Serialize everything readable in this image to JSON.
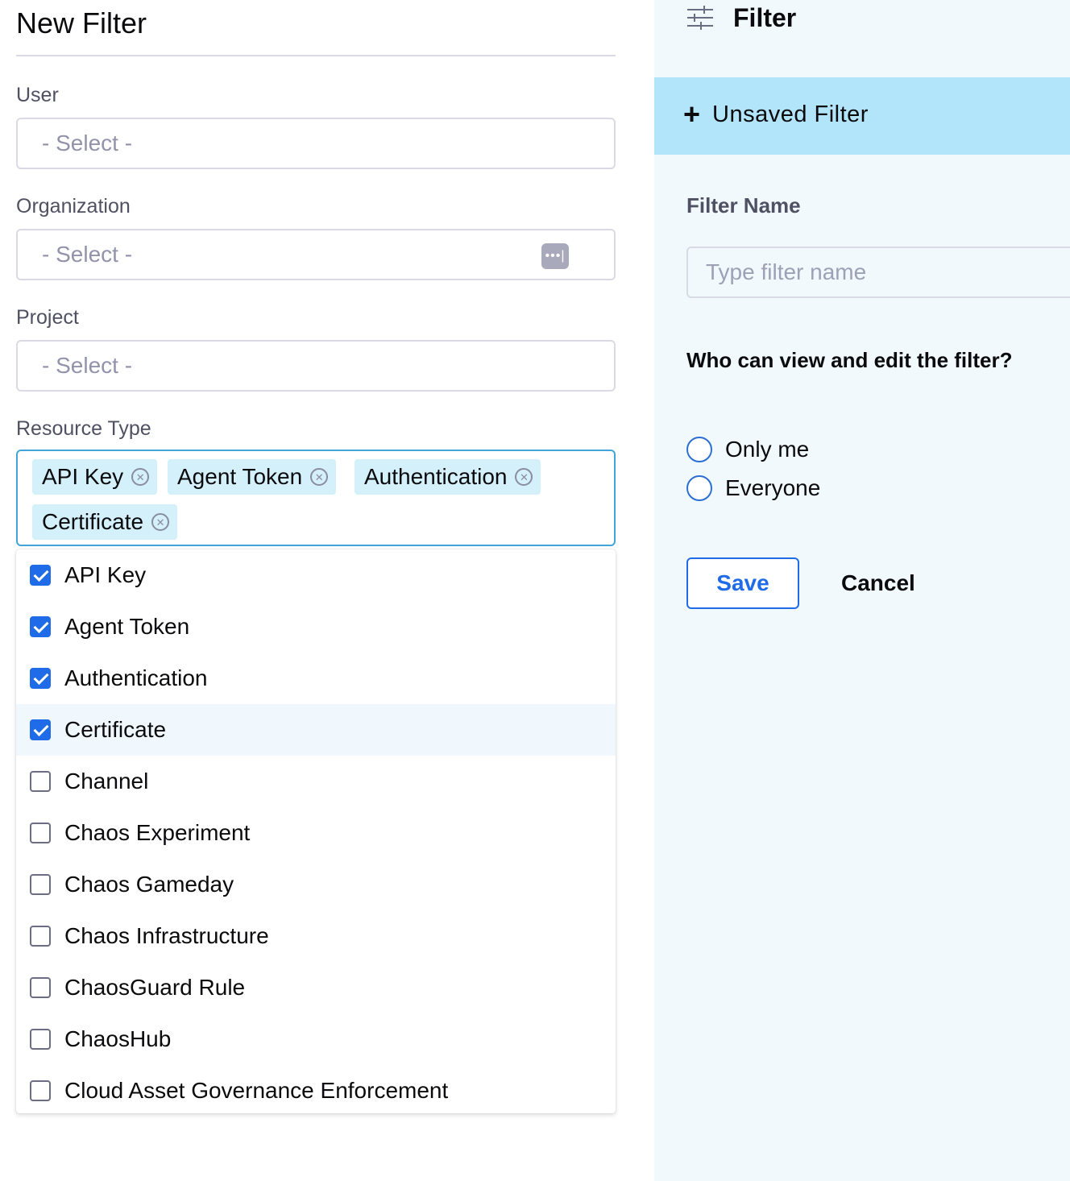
{
  "left": {
    "title": "New Filter",
    "fields": {
      "user": {
        "label": "User",
        "placeholder": "- Select -"
      },
      "organization": {
        "label": "Organization",
        "placeholder": "- Select -",
        "button": "•••|"
      },
      "project": {
        "label": "Project",
        "placeholder": "- Select -"
      },
      "resource_type": {
        "label": "Resource Type"
      }
    },
    "chips": [
      "API Key",
      "Agent Token",
      "Authentication",
      "Certificate"
    ],
    "chip_remove_glyph": "✕",
    "options": [
      {
        "label": "API Key",
        "checked": true
      },
      {
        "label": "Agent Token",
        "checked": true
      },
      {
        "label": "Authentication",
        "checked": true
      },
      {
        "label": "Certificate",
        "checked": true
      },
      {
        "label": "Channel",
        "checked": false
      },
      {
        "label": "Chaos Experiment",
        "checked": false
      },
      {
        "label": "Chaos Gameday",
        "checked": false
      },
      {
        "label": "Chaos Infrastructure",
        "checked": false
      },
      {
        "label": "ChaosGuard Rule",
        "checked": false
      },
      {
        "label": "ChaosHub",
        "checked": false
      },
      {
        "label": "Cloud Asset Governance Enforcement",
        "checked": false
      }
    ]
  },
  "right": {
    "title": "Filter",
    "unsaved_label": "Unsaved Filter",
    "filter_name_label": "Filter Name",
    "filter_name_placeholder": "Type filter name",
    "visibility_question": "Who can view and edit the filter?",
    "radio_options": [
      "Only me",
      "Everyone"
    ],
    "save_label": "Save",
    "cancel_label": "Cancel"
  },
  "colors": {
    "accent": "#1f6be8",
    "chip_bg": "#d4f0fb",
    "unsaved_bg": "#b3e5fa",
    "panel_bg": "#f2f9fd",
    "focus_border": "#42a5d9"
  }
}
